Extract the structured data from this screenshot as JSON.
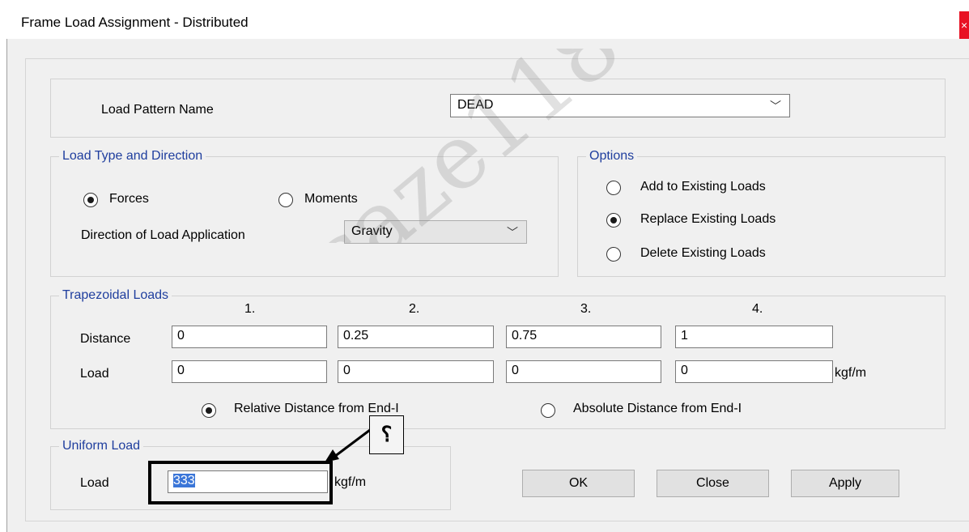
{
  "window": {
    "title": "Frame Load Assignment - Distributed",
    "close_glyph": "×"
  },
  "load_pattern": {
    "label": "Load Pattern Name",
    "value": "DEAD"
  },
  "load_type": {
    "legend": "Load Type and Direction",
    "forces_label": "Forces",
    "forces_selected": true,
    "moments_label": "Moments",
    "moments_selected": false,
    "direction_label": "Direction of Load Application",
    "direction_value": "Gravity"
  },
  "options": {
    "legend": "Options",
    "items": [
      {
        "label": "Add to Existing Loads",
        "selected": false
      },
      {
        "label": "Replace Existing Loads",
        "selected": true
      },
      {
        "label": "Delete Existing Loads",
        "selected": false
      }
    ]
  },
  "trapezoidal": {
    "legend": "Trapezoidal Loads",
    "columns": [
      "1.",
      "2.",
      "3.",
      "4."
    ],
    "distance_label": "Distance",
    "distances": [
      "0",
      "0.25",
      "0.75",
      "1"
    ],
    "load_label": "Load",
    "loads": [
      "0",
      "0",
      "0",
      "0"
    ],
    "units": "kgf/m",
    "relative_label": "Relative Distance from End-I",
    "relative_selected": true,
    "absolute_label": "Absolute Distance from End-I",
    "absolute_selected": false
  },
  "uniform": {
    "legend": "Uniform Load",
    "load_label": "Load",
    "value": "333",
    "units": "kgf/m"
  },
  "buttons": {
    "ok": "OK",
    "close": "Close",
    "apply": "Apply"
  },
  "annotation": {
    "callout_text": "؟",
    "watermark": "saze118"
  }
}
